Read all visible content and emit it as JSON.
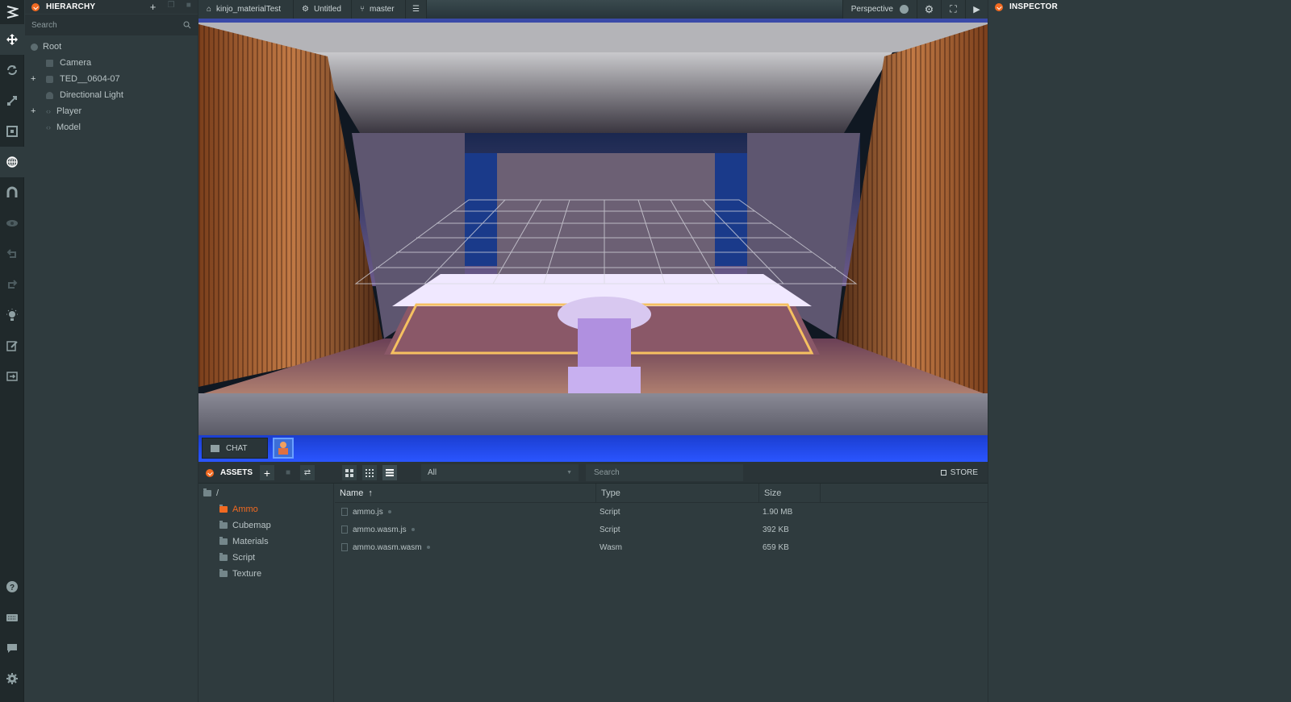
{
  "toolbar": {
    "items": [
      "logo-icon",
      "move-icon",
      "rotate-icon",
      "scale-icon",
      "resize-icon",
      "world-icon",
      "magnet-icon",
      "eye-icon",
      "undo-icon",
      "redo-icon",
      "light-icon",
      "edit-icon",
      "publish-icon"
    ],
    "bottom": [
      "help-icon",
      "keyboard-icon",
      "chat-icon",
      "settings-icon"
    ]
  },
  "hierarchy": {
    "title": "HIERARCHY",
    "search_placeholder": "Search",
    "root": "Root",
    "items": [
      {
        "label": "Camera",
        "expandable": false
      },
      {
        "label": "TED__0604-07",
        "expandable": true
      },
      {
        "label": "Directional Light",
        "expandable": false
      },
      {
        "label": "Player",
        "expandable": true
      },
      {
        "label": "Model",
        "expandable": false
      }
    ]
  },
  "viewport": {
    "project_tab": "kinjo_materialTest",
    "scene_tab": "Untitled",
    "branch_tab": "master",
    "camera_mode": "Perspective"
  },
  "chat": {
    "label": "CHAT"
  },
  "assets": {
    "title": "ASSETS",
    "filter_value": "All",
    "search_placeholder": "Search",
    "store_label": "STORE",
    "root_path": "/",
    "folders": [
      "Ammo",
      "Cubemap",
      "Materials",
      "Script",
      "Texture"
    ],
    "active_folder": "Ammo",
    "columns": {
      "name": "Name",
      "type": "Type",
      "size": "Size"
    },
    "sort_indicator": "↑",
    "files": [
      {
        "name": "ammo.js",
        "type": "Script",
        "size": "1.90 MB"
      },
      {
        "name": "ammo.wasm.js",
        "type": "Script",
        "size": "392 KB"
      },
      {
        "name": "ammo.wasm.wasm",
        "type": "Wasm",
        "size": "659 KB"
      }
    ]
  },
  "inspector": {
    "title": "INSPECTOR"
  },
  "colors": {
    "accent": "#f26a21",
    "panel": "#2f3b3e",
    "chat_bar": "#2a55ff"
  }
}
